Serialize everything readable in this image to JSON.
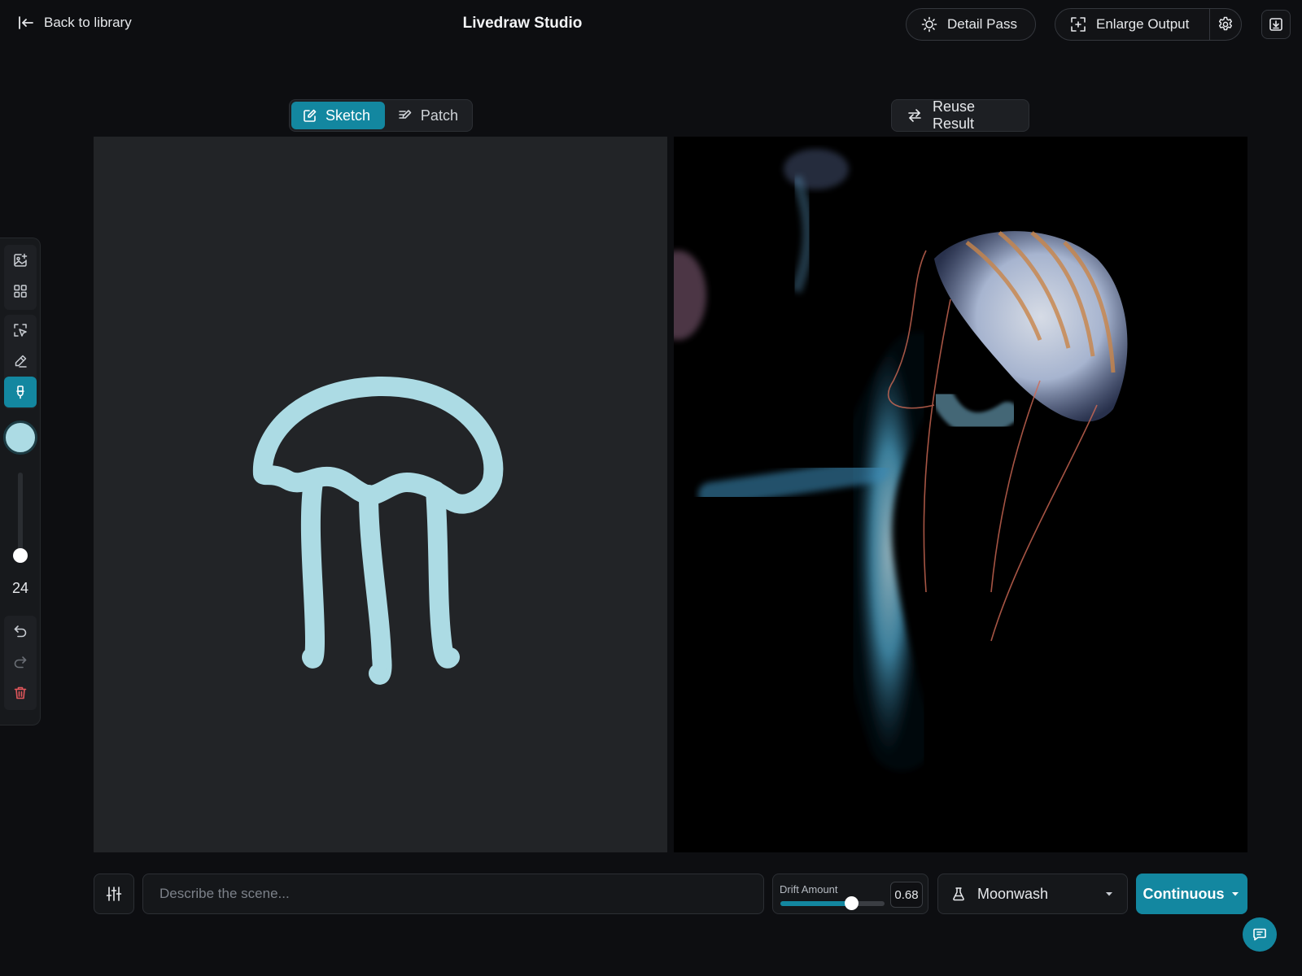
{
  "header": {
    "back_label": "Back to library",
    "title": "Livedraw Studio",
    "detail_pass_label": "Detail Pass",
    "enlarge_label": "Enlarge Output"
  },
  "mode_switch": {
    "tabs": [
      {
        "label": "Sketch",
        "active": true,
        "icon": "pencil-square-icon"
      },
      {
        "label": "Patch",
        "active": false,
        "icon": "patch-edit-icon"
      }
    ]
  },
  "reuse_label": "Reuse Result",
  "toolbar": {
    "tools": [
      "add-image-icon",
      "grid-icon",
      "select-icon",
      "eraser-icon",
      "brush-icon",
      "undo-icon",
      "redo-icon",
      "trash-icon"
    ],
    "active_tool": "brush-icon",
    "brush_color": "#acdbe4",
    "brush_size": "24",
    "brush_size_fraction": 0.05
  },
  "prompt": {
    "placeholder": "Describe the scene...",
    "value": ""
  },
  "drift": {
    "label": "Drift Amount",
    "value": "0.68",
    "fraction": 0.68
  },
  "style": {
    "selected": "Moonwash",
    "icon": "flask-icon"
  },
  "run_mode": {
    "label": "Continuous"
  },
  "colors": {
    "accent": "#1387a0",
    "sketch_stroke": "#acdbe4",
    "background": "#0d0e11",
    "danger": "#e0565b"
  }
}
